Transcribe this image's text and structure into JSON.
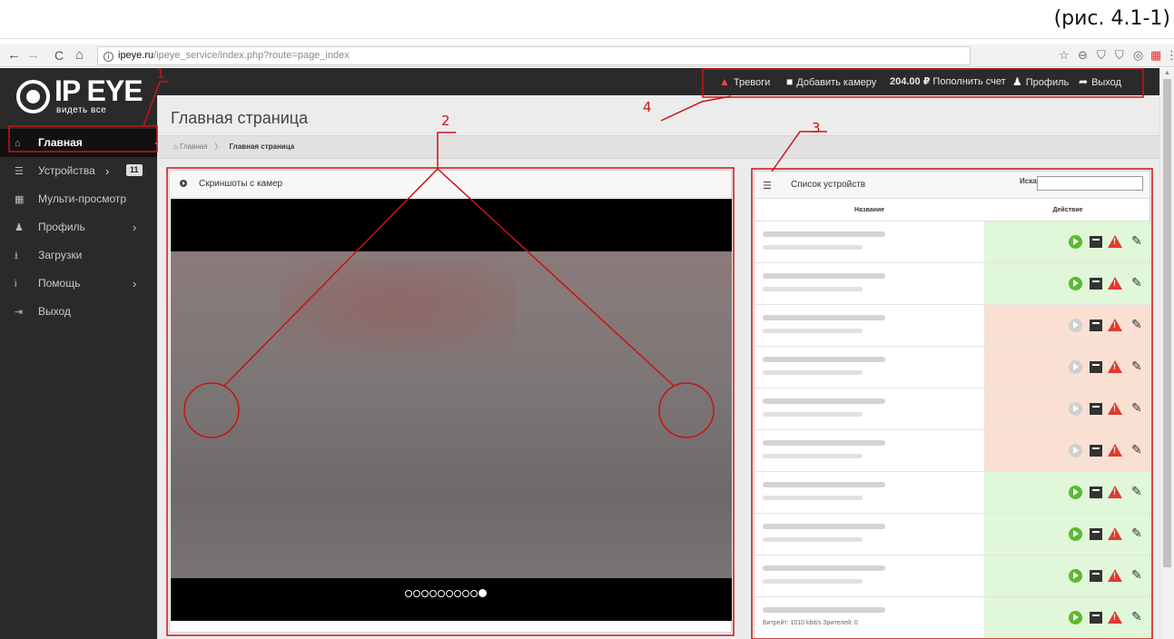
{
  "figure_caption": "(рис. 4.1-1)",
  "browser": {
    "url_host": "ipeye.ru",
    "url_path": "/ipeye_service/index.php?route=page_index",
    "nav_back": "←",
    "nav_forward": "→",
    "nav_reload": "C",
    "nav_home": "⌂",
    "info": "i",
    "extensions": [
      "☆",
      "⊖",
      "⛉",
      "⛉",
      "◎",
      "▦",
      "⋮"
    ]
  },
  "logo": {
    "brand": "IP EYE",
    "tagline": "видеть все"
  },
  "sidebar": {
    "items": [
      {
        "label": "Главная",
        "icon": "home-icon",
        "glyph": "⌂"
      },
      {
        "label": "Устройства",
        "icon": "list-icon",
        "glyph": "☰",
        "badge": "11",
        "arrow": "›"
      },
      {
        "label": "Мульти-просмотр",
        "icon": "grid-icon",
        "glyph": "▦"
      },
      {
        "label": "Профиль",
        "icon": "user-icon",
        "glyph": "♟",
        "arrow": "›"
      },
      {
        "label": "Загрузки",
        "icon": "download-icon",
        "glyph": "⭳"
      },
      {
        "label": "Помощь",
        "icon": "info-icon",
        "glyph": "i",
        "arrow": "›"
      },
      {
        "label": "Выход",
        "icon": "logout-icon",
        "glyph": "⇥"
      }
    ]
  },
  "topbar": {
    "alarms": "Тревоги",
    "add_camera": "Добавить камеру",
    "balance_amount": "204.00 ₽",
    "topup": "Пополнить счет",
    "profile": "Профиль",
    "logout": "Выход"
  },
  "page": {
    "title": "Главная страница",
    "breadcrumb_home": "Главная",
    "breadcrumb_sep": "〉",
    "breadcrumb_current": "Главная страница"
  },
  "screenshots_panel": {
    "title": "Скриншоты с камер",
    "slide_count": 10,
    "active_slide": 10
  },
  "devices_panel": {
    "title": "Список устройств",
    "search_label": "Искать",
    "search_value": "",
    "col_name": "Название",
    "col_action": "Действие",
    "rows": [
      {
        "status": "online",
        "stat_text": ""
      },
      {
        "status": "online",
        "stat_text": ""
      },
      {
        "status": "offline",
        "stat_text": ""
      },
      {
        "status": "offline",
        "stat_text": ""
      },
      {
        "status": "offline",
        "stat_text": ""
      },
      {
        "status": "offline",
        "stat_text": ""
      },
      {
        "status": "online",
        "stat_text": ""
      },
      {
        "status": "online",
        "stat_text": ""
      },
      {
        "status": "online",
        "stat_text": ""
      },
      {
        "status": "online",
        "stat_text": "Битрейт: 1010 kbit/s   Зрителей: 0"
      }
    ]
  },
  "annotations": {
    "n1": "1",
    "n2": "2",
    "n3": "3",
    "n4": "4"
  },
  "colors": {
    "annotation": "#c81414",
    "online": "#5cb832",
    "alarm": "#e23a2c",
    "online_bg": "#e0f7d9",
    "offline_bg": "#f9e0d3"
  }
}
